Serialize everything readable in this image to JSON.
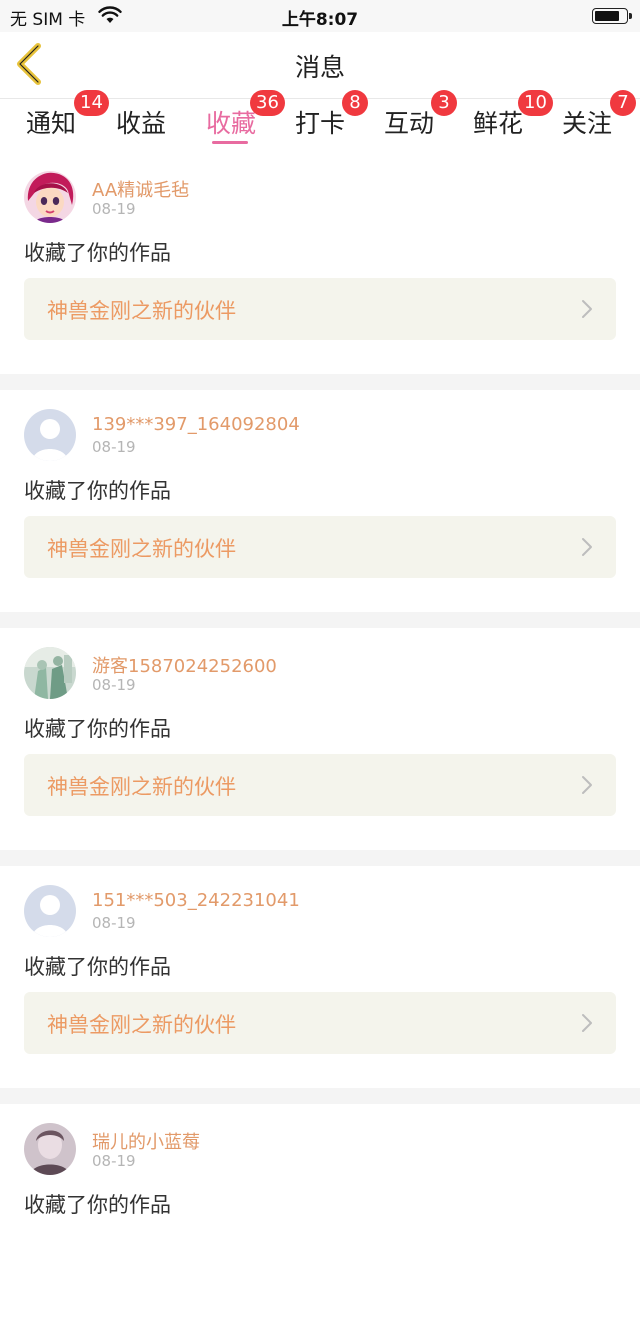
{
  "status_bar": {
    "carrier": "无 SIM 卡",
    "time": "上午8:07"
  },
  "header": {
    "title": "消息",
    "back_icon": "chevron-left-icon"
  },
  "tabs": [
    {
      "label": "通知",
      "badge": "14"
    },
    {
      "label": "收益",
      "badge": ""
    },
    {
      "label": "收藏",
      "badge": "36",
      "active": true
    },
    {
      "label": "打卡",
      "badge": "8"
    },
    {
      "label": "互动",
      "badge": "3"
    },
    {
      "label": "鲜花",
      "badge": "10"
    },
    {
      "label": "关注",
      "badge": "7"
    }
  ],
  "colors": {
    "accent": "#e86ba0",
    "badge": "#f0393f",
    "username": "#e29a6a",
    "work_title": "#ec9a63",
    "card_bg": "#f4f4ec"
  },
  "messages": [
    {
      "username": "AA精诚毛毡",
      "date": "08-19",
      "action": "收藏了你的作品",
      "work": "神兽金刚之新的伙伴",
      "avatar": "cartoon-girl-avatar"
    },
    {
      "username": "139***397_164092804",
      "date": "08-19",
      "action": "收藏了你的作品",
      "work": "神兽金刚之新的伙伴",
      "avatar": "default-avatar"
    },
    {
      "username": "游客1587024252600",
      "date": "08-19",
      "action": "收藏了你的作品",
      "work": "神兽金刚之新的伙伴",
      "avatar": "photo-avatar"
    },
    {
      "username": "151***503_242231041",
      "date": "08-19",
      "action": "收藏了你的作品",
      "work": "神兽金刚之新的伙伴",
      "avatar": "default-avatar"
    },
    {
      "username": "瑞儿的小蓝莓",
      "date": "08-19",
      "action": "收藏了你的作品",
      "work": "",
      "avatar": "photo-avatar"
    }
  ]
}
